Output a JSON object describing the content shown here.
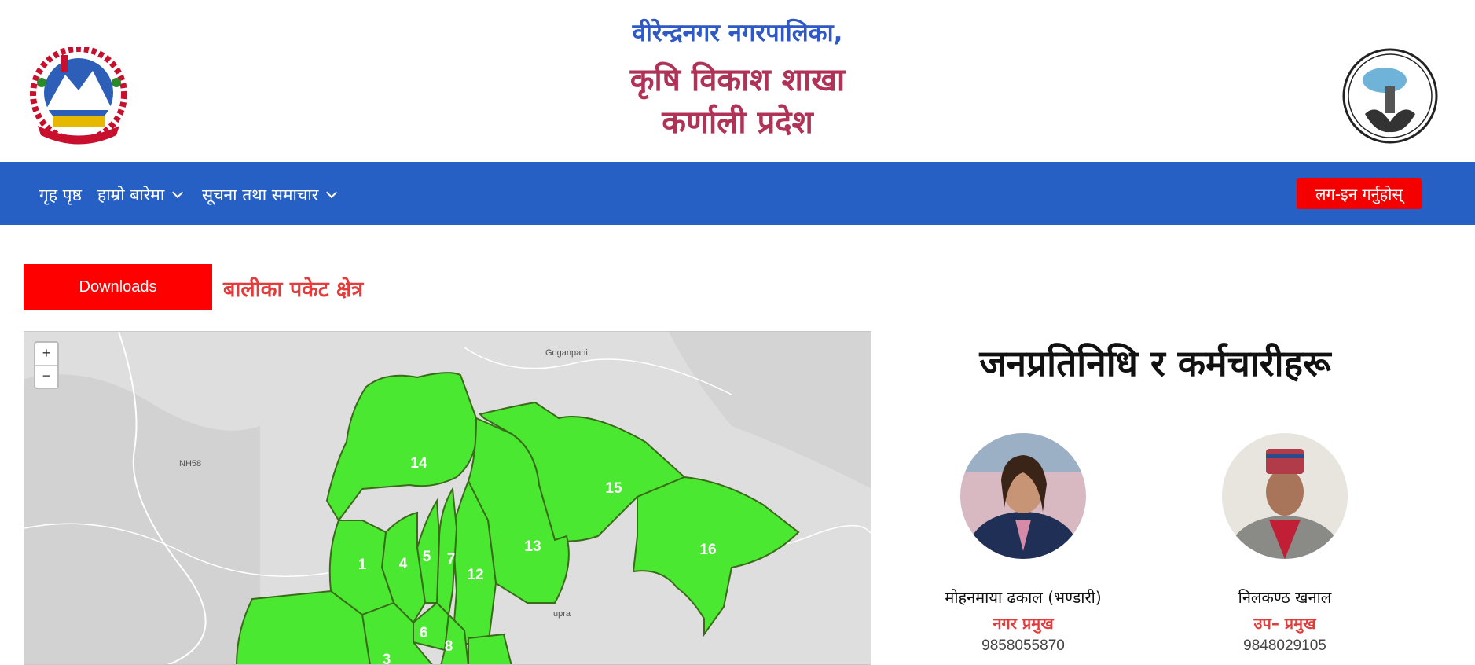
{
  "header": {
    "line1": "वीरेन्द्रनगर नगरपालिका,",
    "line2": "कृषि विकाश शाखा",
    "line3": "कर्णाली प्रदेश"
  },
  "nav": {
    "home": "गृह पृष्ठ",
    "about": "हाम्रो बारेमा",
    "news": "सूचना तथा समाचार",
    "login": "लग-इन गर्नुहोस्"
  },
  "downloads_label": "Downloads",
  "pocket_title": "बालीका पकेट क्षेत्र",
  "map": {
    "zoom_in": "+",
    "zoom_out": "−",
    "place_labels": [
      "Goganpani",
      "NH58",
      "upra"
    ],
    "zone_labels": [
      "14",
      "15",
      "16",
      "13",
      "12",
      "1",
      "4",
      "5",
      "7",
      "6",
      "8",
      "3"
    ]
  },
  "reps": {
    "title": "जनप्रतिनिधि र कर्मचारीहरू",
    "people": [
      {
        "name": "मोहनमाया ढकाल (भण्डारी)",
        "role": "नगर प्रमुख",
        "phone": "9858055870"
      },
      {
        "name": "निलकण्ठ खनाल",
        "role": "उप– प्रमुख",
        "phone": "9848029105"
      }
    ]
  },
  "colors": {
    "nav_bg": "#2760c4",
    "accent_red": "#ff0000",
    "zone_green": "#4ae830",
    "title_blue": "#2f59c4",
    "title_maroon": "#b03357"
  }
}
